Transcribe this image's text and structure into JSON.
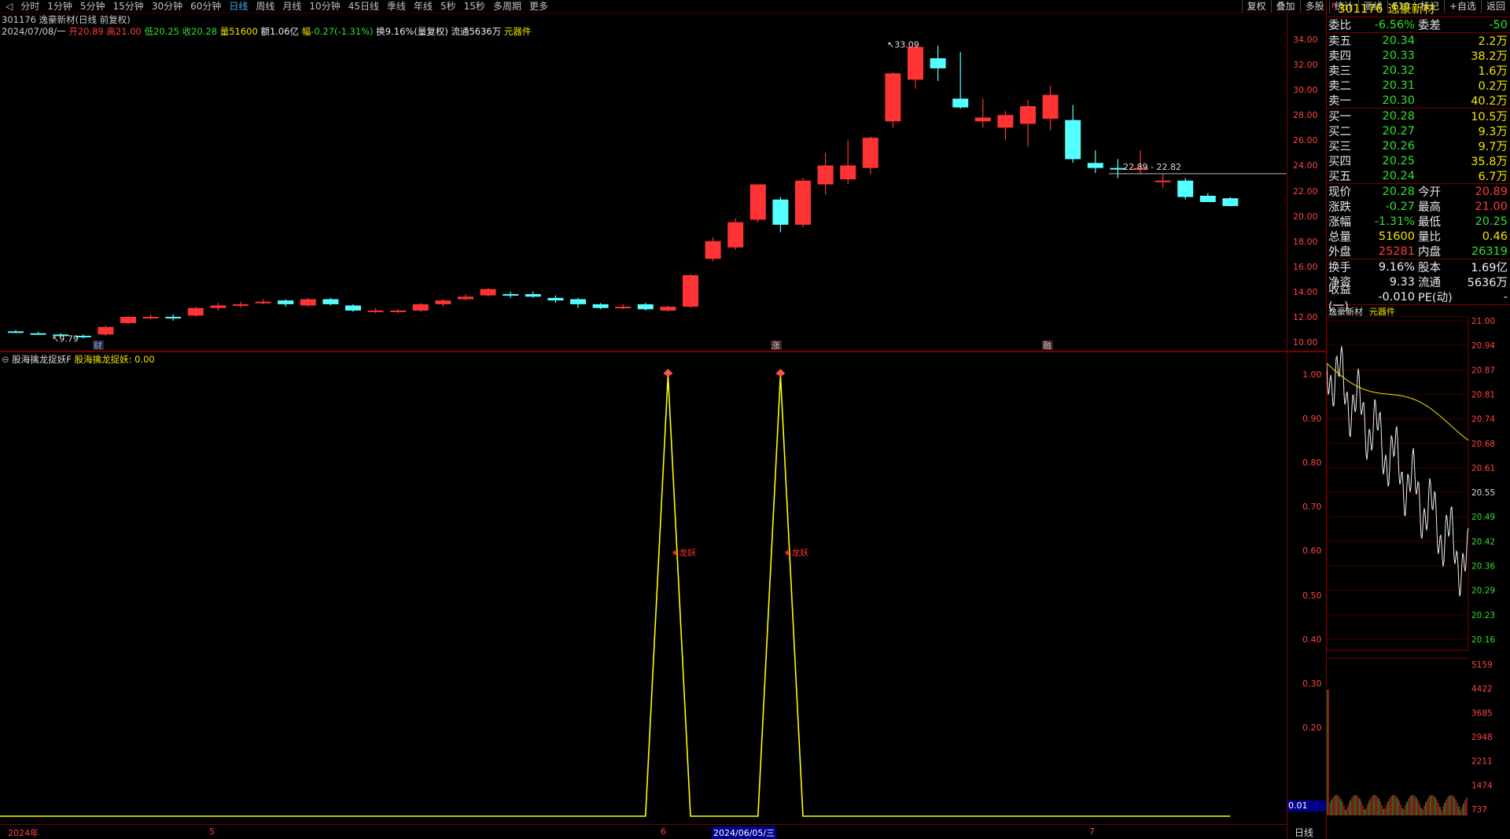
{
  "toolbar": {
    "tabs": [
      "分时",
      "1分钟",
      "5分钟",
      "15分钟",
      "30分钟",
      "60分钟",
      "日线",
      "周线",
      "月线",
      "10分钟",
      "45日线",
      "季线",
      "年线",
      "5秒",
      "15秒",
      "多周期",
      "更多"
    ],
    "active_tab": "日线",
    "right_tools": [
      "复权",
      "叠加",
      "多股",
      "统计",
      "画线",
      "F10",
      "标记",
      "+自选",
      "返回"
    ]
  },
  "header": {
    "title": "301176 逸豪新材(日线 前复权)",
    "date": "2024/07/08/一",
    "open_label": "开",
    "open": "20.89",
    "high_label": "高",
    "high": "21.00",
    "low_label": "低",
    "low": "20.25",
    "close_label": "收",
    "close": "20.28",
    "vol_label": "量",
    "vol": "51600",
    "amt_label": "额",
    "amt": "1.06亿",
    "chg_label": "幅",
    "chg": "-0.27(-1.31%)",
    "turn_label": "换",
    "turn": "9.16%(量复权)",
    "float_label": "流通",
    "float": "5636万",
    "sector": "元器件"
  },
  "indicator": {
    "name": "股海擒龙捉妖F",
    "label": "股海擒龙捉妖:",
    "value": "0.00",
    "signal": "★龙妖",
    "last_value_box": "0.01"
  },
  "chart_annotations": {
    "high_tag": "33.09",
    "low_tag": "9.79",
    "ref_line": "22.89 - 22.82",
    "markers": [
      "财",
      "涨",
      "融"
    ]
  },
  "chart_data": {
    "type": "candlestick",
    "price_axis_ticks": [
      "34.00",
      "32.00",
      "30.00",
      "28.00",
      "26.00",
      "24.00",
      "22.00",
      "20.00",
      "18.00",
      "16.00",
      "14.00",
      "12.00",
      "10.00"
    ],
    "indicator_axis_ticks": [
      "1.00",
      "0.90",
      "0.80",
      "0.70",
      "0.60",
      "0.50",
      "0.40",
      "0.30",
      "0.20"
    ],
    "date_ticks": [
      "2024年",
      "5",
      "6",
      "2024/06/05/三",
      "7"
    ],
    "colors": {
      "up": "#ff3333",
      "down": "#54ffff",
      "indicator": "#ffff00",
      "grid": "#7a0000"
    },
    "candles": [
      [
        10.35,
        10.45,
        10.2,
        10.3
      ],
      [
        10.2,
        10.3,
        10.1,
        10.15
      ],
      [
        10.1,
        10.2,
        9.9,
        10.0
      ],
      [
        10.0,
        10.1,
        9.79,
        9.9
      ],
      [
        10.1,
        10.8,
        10.0,
        10.7
      ],
      [
        11.0,
        11.6,
        10.9,
        11.5
      ],
      [
        11.4,
        11.7,
        11.3,
        11.5
      ],
      [
        11.5,
        11.7,
        11.2,
        11.4
      ],
      [
        11.6,
        12.3,
        11.5,
        12.2
      ],
      [
        12.2,
        12.6,
        12.0,
        12.4
      ],
      [
        12.4,
        12.7,
        12.2,
        12.5
      ],
      [
        12.6,
        12.9,
        12.5,
        12.7
      ],
      [
        12.8,
        12.9,
        12.3,
        12.5
      ],
      [
        12.4,
        13.0,
        12.3,
        12.9
      ],
      [
        12.9,
        13.0,
        12.4,
        12.5
      ],
      [
        12.4,
        12.5,
        11.9,
        12.0
      ],
      [
        12.0,
        12.2,
        11.8,
        12.0
      ],
      [
        11.9,
        12.1,
        11.8,
        12.0
      ],
      [
        12.0,
        12.6,
        11.9,
        12.5
      ],
      [
        12.5,
        12.9,
        12.3,
        12.8
      ],
      [
        12.9,
        13.3,
        12.8,
        13.1
      ],
      [
        13.2,
        13.8,
        13.1,
        13.7
      ],
      [
        13.3,
        13.5,
        13.0,
        13.2
      ],
      [
        13.3,
        13.5,
        13.0,
        13.1
      ],
      [
        13.0,
        13.2,
        12.6,
        12.8
      ],
      [
        12.9,
        13.0,
        12.2,
        12.5
      ],
      [
        12.5,
        12.6,
        12.1,
        12.2
      ],
      [
        12.3,
        12.5,
        12.1,
        12.3
      ],
      [
        12.5,
        12.6,
        12.0,
        12.1
      ],
      [
        12.0,
        12.4,
        11.9,
        12.3
      ],
      [
        12.3,
        14.9,
        12.2,
        14.8
      ],
      [
        16.1,
        17.8,
        15.9,
        17.5
      ],
      [
        17.0,
        19.3,
        16.8,
        19.0
      ],
      [
        19.2,
        22.0,
        19.0,
        22.0
      ],
      [
        20.8,
        21.0,
        18.2,
        18.8
      ],
      [
        18.8,
        22.5,
        18.6,
        22.3
      ],
      [
        22.0,
        24.5,
        21.2,
        23.5
      ],
      [
        22.4,
        25.5,
        22.0,
        23.5
      ],
      [
        23.3,
        25.8,
        22.8,
        25.7
      ],
      [
        27.0,
        30.9,
        26.5,
        30.8
      ],
      [
        30.3,
        33.09,
        29.6,
        32.9
      ],
      [
        32.0,
        33.0,
        30.2,
        31.2
      ],
      [
        28.8,
        32.5,
        28.0,
        28.1
      ],
      [
        27.0,
        28.8,
        26.5,
        27.3
      ],
      [
        26.5,
        27.8,
        25.5,
        27.5
      ],
      [
        26.8,
        28.7,
        25.0,
        28.2
      ],
      [
        27.2,
        29.8,
        26.3,
        29.1
      ],
      [
        27.1,
        28.3,
        23.7,
        24.0
      ],
      [
        23.7,
        24.7,
        22.9,
        23.3
      ],
      [
        23.3,
        24.0,
        22.5,
        23.2
      ],
      [
        23.3,
        24.7,
        22.8,
        23.3
      ],
      [
        22.3,
        22.8,
        21.7,
        22.3
      ],
      [
        22.3,
        22.5,
        20.8,
        21.0
      ],
      [
        21.1,
        21.3,
        20.7,
        20.6
      ],
      [
        20.9,
        21.0,
        20.25,
        20.28
      ]
    ],
    "indicator_values": [
      0,
      0,
      0,
      0,
      0,
      0,
      0,
      0,
      0,
      0,
      0,
      0,
      0,
      0,
      0,
      0,
      0,
      0,
      0,
      0,
      0,
      0,
      0,
      0,
      0,
      0,
      0,
      0,
      0,
      1,
      0,
      0,
      0,
      0,
      1,
      0,
      0,
      0,
      0,
      0,
      0,
      0,
      0,
      0,
      0,
      0,
      0,
      0,
      0,
      0,
      0,
      0,
      0,
      0,
      0
    ]
  },
  "quote": {
    "code": "301176",
    "name": "逸豪新材",
    "weibi_label": "委比",
    "weibi": "-6.56%",
    "weicha_label": "委差",
    "weicha": "-50",
    "asks": [
      {
        "label": "卖五",
        "price": "20.34",
        "vol": "2.2万"
      },
      {
        "label": "卖四",
        "price": "20.33",
        "vol": "38.2万"
      },
      {
        "label": "卖三",
        "price": "20.32",
        "vol": "1.6万"
      },
      {
        "label": "卖二",
        "price": "20.31",
        "vol": "0.2万"
      },
      {
        "label": "卖一",
        "price": "20.30",
        "vol": "40.2万"
      }
    ],
    "bids": [
      {
        "label": "买一",
        "price": "20.28",
        "vol": "10.5万"
      },
      {
        "label": "买二",
        "price": "20.27",
        "vol": "9.3万"
      },
      {
        "label": "买三",
        "price": "20.26",
        "vol": "9.7万"
      },
      {
        "label": "买四",
        "price": "20.25",
        "vol": "35.8万"
      },
      {
        "label": "买五",
        "price": "20.24",
        "vol": "6.7万"
      }
    ],
    "stats": [
      {
        "l1": "现价",
        "v1": "20.28",
        "l2": "今开",
        "v2": "20.89"
      },
      {
        "l1": "涨跌",
        "v1": "-0.27",
        "l2": "最高",
        "v2": "21.00"
      },
      {
        "l1": "涨幅",
        "v1": "-1.31%",
        "l2": "最低",
        "v2": "20.25"
      },
      {
        "l1": "总量",
        "v1": "51600",
        "l2": "量比",
        "v2": "0.46"
      },
      {
        "l1": "外盘",
        "v1": "25281",
        "l2": "内盘",
        "v2": "26319"
      }
    ],
    "stats2": [
      {
        "l1": "换手",
        "v1": "9.16%",
        "l2": "股本",
        "v2": "1.69亿"
      },
      {
        "l1": "净资",
        "v1": "9.33",
        "l2": "流通",
        "v2": "5636万"
      },
      {
        "l1": "收益(一)",
        "v1": "-0.010",
        "l2": "PE(动)",
        "v2": "-"
      }
    ]
  },
  "mini_chart": {
    "title": "逸豪新材",
    "sector": "元器件",
    "price_ticks": [
      "21.00",
      "20.94",
      "20.87",
      "20.81",
      "20.74",
      "20.68",
      "20.61",
      "20.55",
      "20.49",
      "20.42",
      "20.36",
      "20.29",
      "20.23",
      "20.16"
    ],
    "vol_ticks": [
      "5159",
      "4422",
      "3685",
      "2948",
      "2211",
      "1474",
      "737"
    ],
    "period_label": "日线"
  }
}
